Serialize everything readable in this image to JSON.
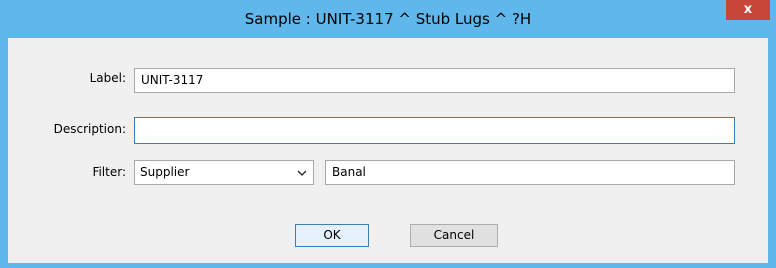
{
  "window": {
    "title": "Sample : UNIT-3117 ^ Stub Lugs ^ ?H",
    "close_glyph": "x"
  },
  "form": {
    "label_caption": "Label:",
    "label_value": "UNIT-3117",
    "description_caption": "Description:",
    "description_value": "",
    "filter_caption": "Filter:",
    "filter_field_selected": "Supplier",
    "filter_value": "Banal"
  },
  "buttons": {
    "ok": "OK",
    "cancel": "Cancel"
  },
  "colors": {
    "titlebar": "#5fb7ec",
    "close": "#c9463a",
    "client": "#f0f0f0",
    "focus_border": "#3c7fb1"
  },
  "icons": {
    "close": "close-icon",
    "dropdown": "chevron-down-icon"
  }
}
